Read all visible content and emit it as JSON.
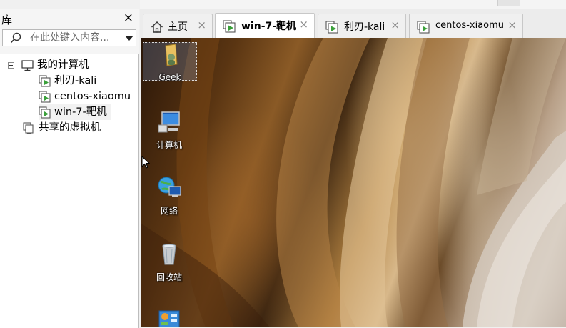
{
  "library": {
    "title": "库",
    "close_label": "×",
    "search_placeholder": "在此处键入内容...",
    "tree": {
      "root_label": "我的计算机",
      "vms": [
        "利刃-kali",
        "centos-xiaomu",
        "win-7-靶机"
      ],
      "shared_label": "共享的虚拟机"
    }
  },
  "tabs": [
    {
      "label": "主页",
      "icon": "home-icon",
      "active": false
    },
    {
      "label": "win-7-靶机",
      "icon": "vm-icon",
      "active": true
    },
    {
      "label": "利刃-kali",
      "icon": "vm-icon",
      "active": false
    },
    {
      "label": "centos-xiaomu",
      "icon": "vm-icon",
      "active": false
    }
  ],
  "tab_close_label": "×",
  "desktop": {
    "icons": [
      {
        "label": "Geek",
        "icon": "user-folder-icon"
      },
      {
        "label": "计算机",
        "icon": "computer-icon"
      },
      {
        "label": "网络",
        "icon": "network-icon"
      },
      {
        "label": "回收站",
        "icon": "recycle-bin-icon"
      },
      {
        "label": "",
        "icon": "control-panel-icon"
      }
    ]
  },
  "colors": {
    "accent": "#0078d7",
    "vm_green": "#3aa03a"
  }
}
